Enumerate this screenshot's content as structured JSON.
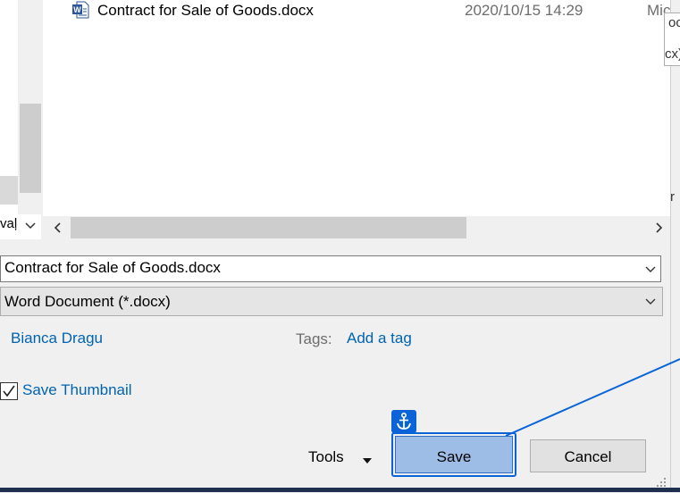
{
  "left_pane": {
    "truncated_text": "vaļ",
    "chevron_icon": "chevron-down-icon"
  },
  "file_list": {
    "rows": [
      {
        "icon": "word-document-icon",
        "name": "Contract for Sale of Goods.docx",
        "date_modified": "2020/10/15 14:29",
        "type_truncated": "Mic"
      }
    ]
  },
  "hscroll": {
    "left_icon": "chevron-left-icon",
    "right_icon": "chevron-right-icon"
  },
  "right_pane_fragments": {
    "frag1": "oc",
    "frag2": "cx)",
    "frag3": "r"
  },
  "form": {
    "filename": "Contract for Sale of Goods.docx",
    "filetype": "Word Document (*.docx)",
    "author": "Bianca Dragu",
    "tags_label": "Tags:",
    "tags_link": "Add a tag",
    "save_thumbnail_label": "Save Thumbnail",
    "save_thumbnail_checked": true
  },
  "footer": {
    "tools_label": "Tools",
    "save_label": "Save",
    "cancel_label": "Cancel",
    "anchor_icon": "anchor-icon"
  },
  "colors": {
    "link": "#0063b1",
    "accent": "#0a64d8",
    "save_fill": "#9ebde6",
    "background": "#f0f0f0"
  }
}
